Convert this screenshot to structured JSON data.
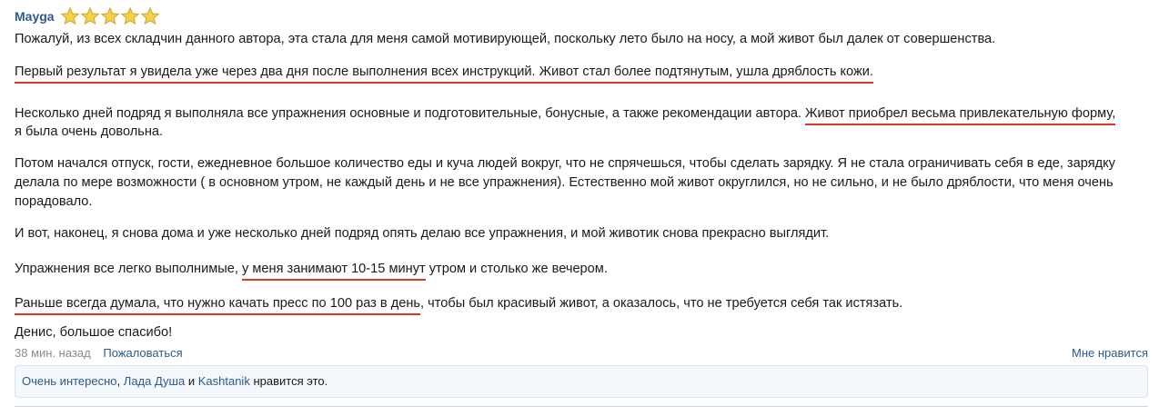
{
  "post": {
    "author": "Mayga",
    "rating": 5,
    "paragraphs": {
      "p1": "Пожалуй, из всех складчин данного автора, эта стала для меня самой мотивирующей, поскольку лето было на носу, а мой живот был далек от совершенства.",
      "p2_hl": "Первый результат я увидела уже через два дня после выполнения всех инструкций. Живот стал более подтянутым, ушла дряблость кожи.",
      "p3_a": "Несколько дней подряд я выполняла все упражнения основные и подготовительные, бонусные, а также рекомендации автора. ",
      "p3_hl": "Живот приобрел весьма привлекательную форму,",
      "p3_b": "я была очень довольна.",
      "p4_l1": "Потом начался отпуск, гости, ежедневное большое количество еды и куча людей вокруг, что не спрячешься, чтобы сделать зарядку. Я не стала ограничивать себя в еде, зарядку",
      "p4_l2": "делала по мере возможности ( в основном утром, не каждый день и не все упражнения). Естественно мой живот округлился, но не сильно, и не было дряблости, что меня очень",
      "p4_l3": "порадовало.",
      "p5": "И вот, наконец, я снова дома и уже несколько дней подряд опять делаю все упражнения, и мой животик снова прекрасно выглядит.",
      "p6_a": "Упражнения все легко выполнимые, ",
      "p6_hl": "у меня занимают 10-15 минут",
      "p6_b": " утром и столько же вечером.",
      "p7_hl": "Раньше всегда думала, что нужно качать пресс по 100 раз в день",
      "p7_b": ", чтобы был красивый живот, а оказалось, что не требуется себя так истязать.",
      "p8": "Денис, большое спасибо!"
    },
    "meta": {
      "time": "38 мин. назад",
      "report": "Пожаловаться",
      "like": "Мне нравится"
    },
    "likes": {
      "user1": "Очень интересно",
      "comma": ",",
      "user2": "Лада Душа",
      "and": "и",
      "user3": "Kashtanik",
      "suffix": "нравится это."
    }
  }
}
